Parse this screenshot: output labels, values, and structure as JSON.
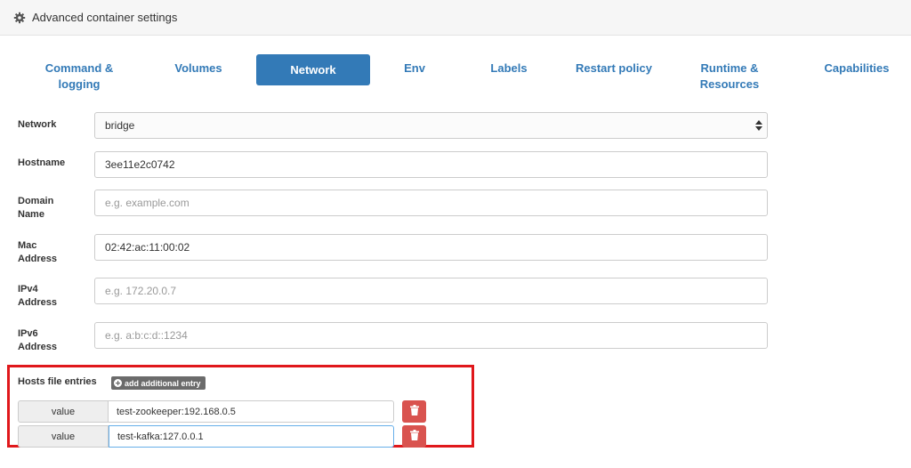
{
  "header": {
    "title": "Advanced container settings",
    "icon": "gear-icon"
  },
  "tabs": [
    {
      "label": "Command &\nlogging"
    },
    {
      "label": "Volumes"
    },
    {
      "label": "Network"
    },
    {
      "label": "Env"
    },
    {
      "label": "Labels"
    },
    {
      "label": "Restart policy"
    },
    {
      "label": "Runtime &\nResources"
    },
    {
      "label": "Capabilities"
    }
  ],
  "active_tab": "Network",
  "form": {
    "network": {
      "label": "Network",
      "value": "bridge"
    },
    "hostname": {
      "label": "Hostname",
      "value": "3ee11e2c0742"
    },
    "domain": {
      "label": "Domain\nName",
      "placeholder": "e.g. example.com"
    },
    "mac": {
      "label": "Mac\nAddress",
      "value": "02:42:ac:11:00:02"
    },
    "ipv4": {
      "label": "IPv4\nAddress",
      "placeholder": "e.g. 172.20.0.7"
    },
    "ipv6": {
      "label": "IPv6\nAddress",
      "placeholder": "e.g. a:b:c:d::1234"
    }
  },
  "hosts": {
    "label": "Hosts file entries",
    "add_label": "add additional entry",
    "entries": [
      {
        "addon": "value",
        "value": "test-zookeeper:192.168.0.5"
      },
      {
        "addon": "value",
        "value": "test-kafka:127.0.0.1"
      }
    ]
  },
  "colors": {
    "accent": "#337ab7",
    "danger": "#d9534f",
    "highlight": "#e0181b"
  }
}
